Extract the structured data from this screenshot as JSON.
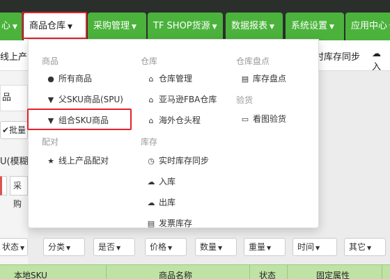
{
  "nav": {
    "tabs": [
      {
        "label": "心",
        "caret": "▼"
      },
      {
        "label": "商品仓库",
        "caret": "▼"
      },
      {
        "label": "采购管理",
        "caret": "▼"
      },
      {
        "label": "TF SHOP货源",
        "caret": "▼"
      },
      {
        "label": "数据报表",
        "caret": "▼"
      },
      {
        "label": "系统设置",
        "caret": "▼"
      },
      {
        "label": "应用中心",
        "caret": "▼"
      }
    ]
  },
  "subbar": {
    "left_text": "线上产品",
    "right1_text": "时库存同步",
    "right2_text": "入"
  },
  "left": {
    "tab_label": "品",
    "batch_button": "批量",
    "search_mode": "U(模糊)",
    "combo_text": "采购"
  },
  "dropdown": {
    "sections": {
      "goods": "商品",
      "match": "配对",
      "warehouse": "仓库",
      "stock": "库存",
      "check": "仓库盘点",
      "inspect": "验货"
    },
    "items": {
      "all_goods": "所有商品",
      "parent_sku": "父SKU商品(SPU)",
      "combo_sku": "组合SKU商品",
      "online_match": "线上产品配对",
      "wh_manage": "仓库管理",
      "amazon_fba": "亚马逊FBA仓库",
      "overseas": "海外仓头程",
      "realtime_sync": "实时库存同步",
      "stock_in": "入库",
      "stock_out": "出库",
      "invoice_stock": "发票库存",
      "stock_check": "库存盘点",
      "view_inspect": "看图验货"
    },
    "icons": {
      "all_goods": "●",
      "parent_sku": "▼",
      "combo_sku": "▼",
      "online_match": "★",
      "wh_manage": "⌂",
      "amazon_fba": "⌂",
      "overseas": "⌂",
      "realtime_sync": "◷",
      "stock_in": "☁",
      "stock_out": "☁",
      "invoice_stock": "▤",
      "stock_check": "▤",
      "view_inspect": "▭"
    }
  },
  "filters": [
    {
      "label": "状态",
      "caret": "▼"
    },
    {
      "label": "分类",
      "caret": "▼"
    },
    {
      "label": "是否",
      "caret": "▼"
    },
    {
      "label": "价格",
      "caret": "▼"
    },
    {
      "label": "数量",
      "caret": "▼"
    },
    {
      "label": "重量",
      "caret": "▼"
    },
    {
      "label": "时间",
      "caret": "▼"
    },
    {
      "label": "其它",
      "caret": "▼"
    }
  ],
  "table": {
    "headers": [
      "本地SKU",
      "商品名称",
      "状态",
      "固定属性"
    ]
  },
  "colors": {
    "nav_bg": "#2a2f2c",
    "nav_tab": "#4bb33c",
    "highlight": "#e3212b",
    "table_header": "#bfe3a4"
  }
}
